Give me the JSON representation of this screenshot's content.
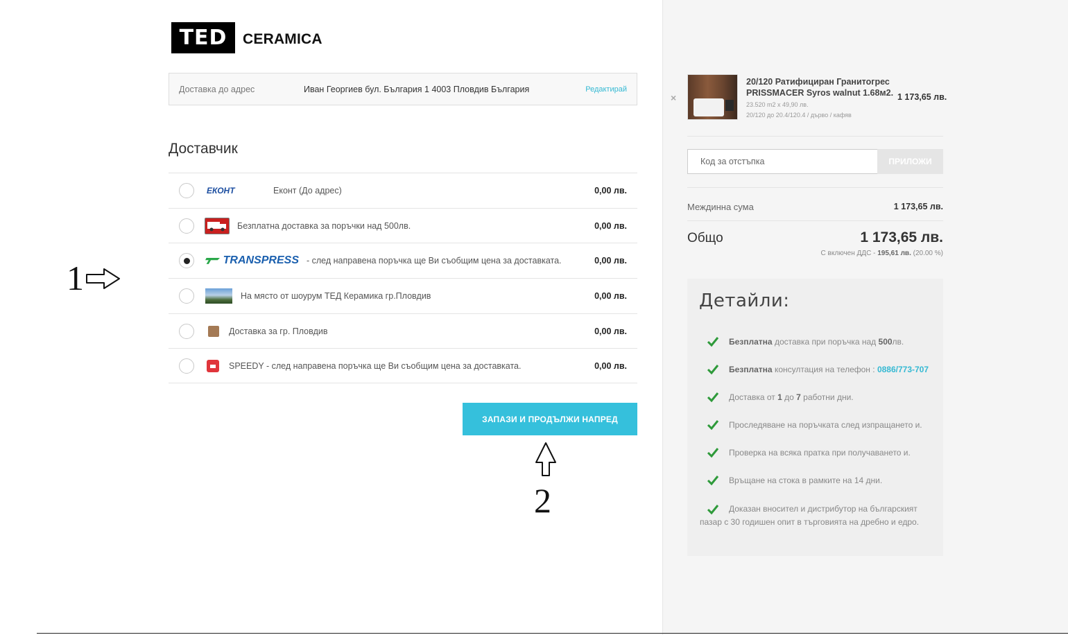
{
  "brand": {
    "logo_mark": "TED",
    "logo_text": "CERAMICA"
  },
  "address": {
    "label": "Доставка до адрес",
    "value": "Иван Георгиев бул. България 1 4003 Пловдив България",
    "edit_label": "Редактирай"
  },
  "shipping": {
    "title": "Доставчик",
    "options": [
      {
        "logo": "econt-logo",
        "logo_text": "ЕКОНТ",
        "label": "Еконт (До адрес)",
        "price": "0,00 лв.",
        "selected": false
      },
      {
        "logo": "truck-icon",
        "label": "Безплатна доставка за поръчки над 500лв.",
        "price": "0,00 лв.",
        "selected": false
      },
      {
        "logo": "transpress-logo",
        "logo_text": "TRANSPRESS",
        "label": "- след направена поръчка ще Ви съобщим цена за доставката.",
        "price": "0,00 лв.",
        "selected": true
      },
      {
        "logo": "showroom-icon",
        "label": "На място от шоурум ТЕД Керамика гр.Пловдив",
        "price": "0,00 лв.",
        "selected": false
      },
      {
        "logo": "box-icon",
        "label": "Доставка за гр. Пловдив",
        "price": "0,00 лв.",
        "selected": false
      },
      {
        "logo": "speedy-logo",
        "label": "SPEEDY - след направена поръчка ще Ви съобщим цена за доставката.",
        "price": "0,00 лв.",
        "selected": false
      }
    ],
    "save_label": "ЗАПАЗИ И ПРОДЪЛЖИ НАПРЕД"
  },
  "annotations": {
    "one": "1",
    "two": "2"
  },
  "cart": {
    "remove_symbol": "×",
    "product": {
      "title": "20/120 Ратифициран Гранитогрес PRISSMACER Syros walnut 1.68м2.",
      "meta_qty": "23.520 m2 x 49,90 лв.",
      "meta_variant": "20/120 до 20.4/120.4 / дърво / кафяв",
      "price": "1 173,65 лв."
    },
    "coupon": {
      "placeholder": "Код за отстъпка",
      "button": "ПРИЛОЖИ"
    },
    "subtotal_label": "Междинна сума",
    "subtotal_value": "1 173,65 лв.",
    "total_label": "Общо",
    "total_value": "1 173,65 лв.",
    "vat_prefix": "С включен ДДС -",
    "vat_amount": "195,61 лв.",
    "vat_rate": "(20.00 %)"
  },
  "details": {
    "title": "Детайли:",
    "items": [
      {
        "bold": "Безплатна",
        "text": " доставка при поръчка над ",
        "bold2": "500",
        "text2": "лв."
      },
      {
        "bold": "Безплатна",
        "text": " консултация на телефон : ",
        "phone": "0886/773-707"
      },
      {
        "text": "Доставка от ",
        "bold": "1",
        "text2": " до ",
        "bold2": "7",
        "text3": " работни дни."
      },
      {
        "text": "Проследяване на поръчката след изпращането и."
      },
      {
        "text": "Проверка на всяка пратка при получаването и."
      },
      {
        "text": "Връщане на стока в рамките на 14 дни."
      },
      {
        "text": "Доказан вносител и дистрибутор на българският пазар с 30 годишен опит в търговията на дребно и едро."
      }
    ]
  },
  "colors": {
    "accent": "#35c0dc",
    "link": "#35b9d3",
    "check": "#2e9a3a"
  }
}
